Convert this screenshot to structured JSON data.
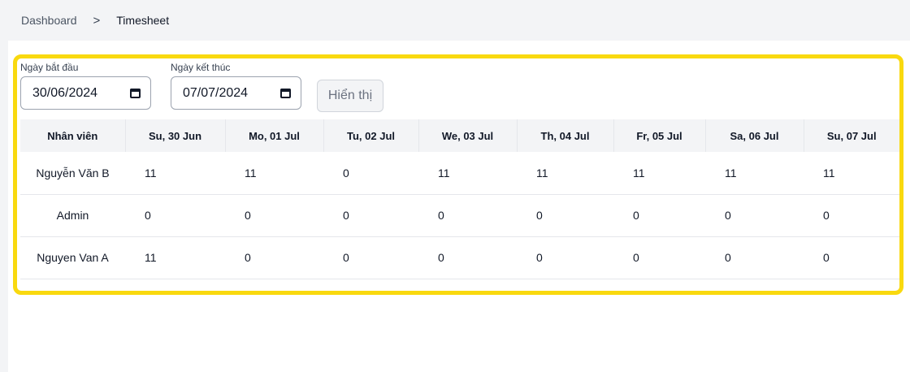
{
  "breadcrumb": {
    "home": "Dashboard",
    "separator": ">",
    "current": "Timesheet"
  },
  "filters": {
    "start_label": "Ngày bắt đầu",
    "start_value": "30/06/2024",
    "end_label": "Ngày kết thúc",
    "end_value": "07/07/2024",
    "show_button": "Hiển thị"
  },
  "table": {
    "headers": [
      "Nhân viên",
      "Su, 30 Jun",
      "Mo, 01 Jul",
      "Tu, 02 Jul",
      "We, 03 Jul",
      "Th, 04 Jul",
      "Fr, 05 Jul",
      "Sa, 06 Jul",
      "Su, 07 Jul"
    ],
    "rows": [
      {
        "name": "Nguyễn Văn B",
        "values": [
          "11",
          "11",
          "0",
          "11",
          "11",
          "11",
          "11",
          "11"
        ]
      },
      {
        "name": "Admin",
        "values": [
          "0",
          "0",
          "0",
          "0",
          "0",
          "0",
          "0",
          "0"
        ]
      },
      {
        "name": "Nguyen Van A",
        "values": [
          "11",
          "0",
          "0",
          "0",
          "0",
          "0",
          "0",
          "0"
        ]
      }
    ]
  },
  "colors": {
    "highlight_border": "#f9d90f",
    "header_bg": "#f3f4f6"
  }
}
